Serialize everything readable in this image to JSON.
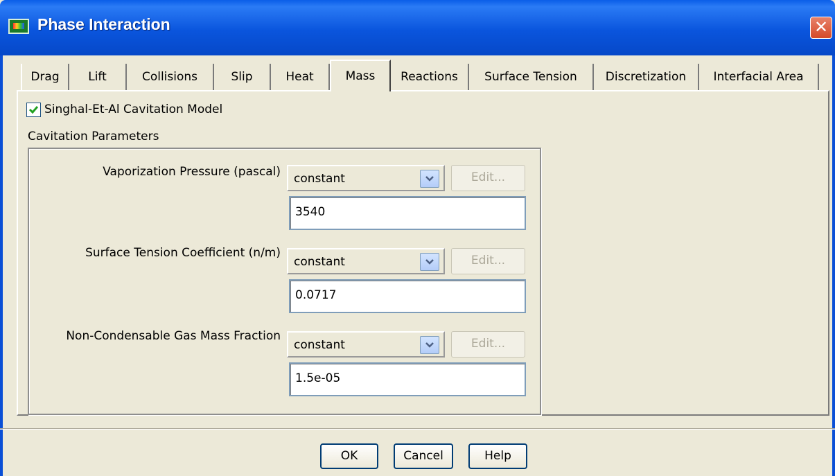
{
  "window": {
    "title": "Phase Interaction",
    "close_glyph": "✕"
  },
  "tabs": [
    {
      "label": "Drag"
    },
    {
      "label": "Lift"
    },
    {
      "label": "Collisions"
    },
    {
      "label": "Slip"
    },
    {
      "label": "Heat"
    },
    {
      "label": "Mass",
      "active": true
    },
    {
      "label": "Reactions"
    },
    {
      "label": "Surface Tension"
    },
    {
      "label": "Discretization"
    },
    {
      "label": "Interfacial Area"
    }
  ],
  "mass": {
    "cavitation_model": {
      "label": "Singhal-Et-Al Cavitation Model",
      "checked": true
    },
    "group_title": "Cavitation Parameters",
    "params": [
      {
        "label": "Vaporization Pressure (pascal)",
        "method": "constant",
        "edit": "Edit...",
        "value": "3540"
      },
      {
        "label": "Surface Tension Coefficient (n/m)",
        "method": "constant",
        "edit": "Edit...",
        "value": "0.0717"
      },
      {
        "label": "Non-Condensable Gas Mass Fraction",
        "method": "constant",
        "edit": "Edit...",
        "value": "1.5e-05"
      }
    ]
  },
  "buttons": {
    "ok": "OK",
    "cancel": "Cancel",
    "help": "Help"
  },
  "icons": {
    "window": "app-icon",
    "checkbox": "checkmark-icon",
    "dropdown": "chevron-down-icon",
    "close": "close-icon"
  },
  "colors": {
    "titlebar": "#0a5ee8",
    "dialog_bg": "#ece9d8",
    "close_button": "#d54a28"
  }
}
